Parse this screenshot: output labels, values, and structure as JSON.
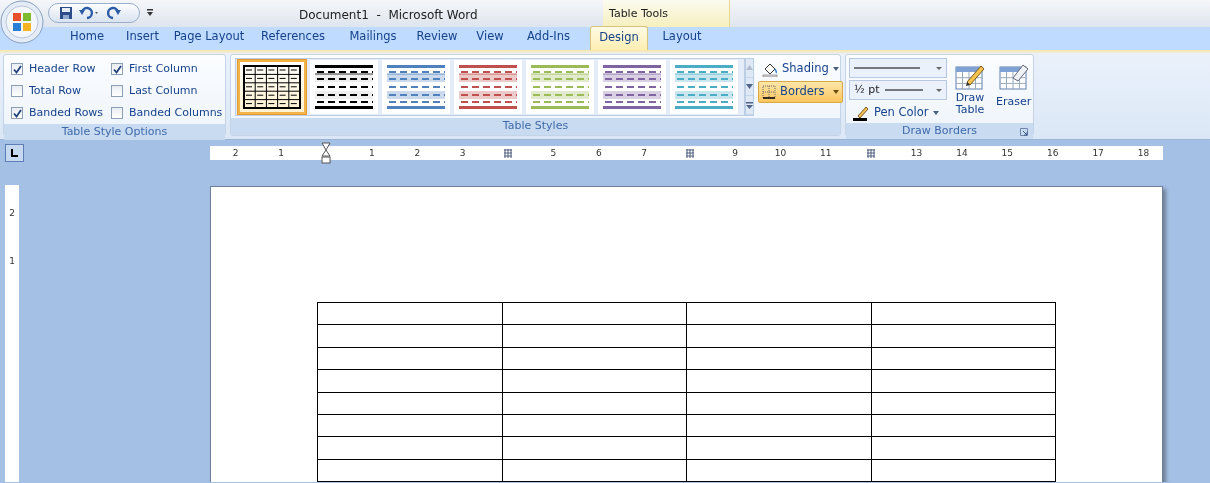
{
  "window": {
    "title": "Document1  -  Microsoft Word",
    "contextual_header": "Table Tools"
  },
  "tabs": [
    {
      "label": "Home",
      "selected": false
    },
    {
      "label": "Insert",
      "selected": false
    },
    {
      "label": "Page Layout",
      "selected": false
    },
    {
      "label": "References",
      "selected": false
    },
    {
      "label": "Mailings",
      "selected": false
    },
    {
      "label": "Review",
      "selected": false
    },
    {
      "label": "View",
      "selected": false
    },
    {
      "label": "Add-Ins",
      "selected": false
    },
    {
      "label": "Design",
      "selected": true
    },
    {
      "label": "Layout",
      "selected": false
    }
  ],
  "table_style_options": {
    "label": "Table Style Options",
    "options": [
      {
        "label": "Header Row",
        "checked": true
      },
      {
        "label": "First Column",
        "checked": true
      },
      {
        "label": "Total Row",
        "checked": false
      },
      {
        "label": "Last Column",
        "checked": false
      },
      {
        "label": "Banded Rows",
        "checked": true
      },
      {
        "label": "Banded Columns",
        "checked": false
      }
    ]
  },
  "table_styles": {
    "label": "Table Styles",
    "styles": [
      {
        "kind": "grid",
        "color": "#000000",
        "selected": true
      },
      {
        "kind": "banded",
        "color": "#000000",
        "selected": false
      },
      {
        "kind": "banded",
        "color": "#4f81bd",
        "selected": false
      },
      {
        "kind": "banded",
        "color": "#c0504d",
        "selected": false
      },
      {
        "kind": "banded",
        "color": "#9bbb59",
        "selected": false
      },
      {
        "kind": "banded",
        "color": "#8064a2",
        "selected": false
      },
      {
        "kind": "banded",
        "color": "#4bacc6",
        "selected": false
      }
    ],
    "shading": "Shading",
    "borders": "Borders"
  },
  "draw_borders": {
    "label": "Draw Borders",
    "weight": "½ pt",
    "pen_color": "Pen Color",
    "draw_table": "Draw Table",
    "eraser": "Eraser"
  },
  "ruler": [
    {
      "kind": "number",
      "label": "2"
    },
    {
      "kind": "number",
      "label": "1"
    },
    {
      "kind": "margin"
    },
    {
      "kind": "number",
      "label": "1"
    },
    {
      "kind": "number",
      "label": "2"
    },
    {
      "kind": "number",
      "label": "3"
    },
    {
      "kind": "marker"
    },
    {
      "kind": "number",
      "label": "5"
    },
    {
      "kind": "number",
      "label": "6"
    },
    {
      "kind": "number",
      "label": "7"
    },
    {
      "kind": "marker"
    },
    {
      "kind": "number",
      "label": "9"
    },
    {
      "kind": "number",
      "label": "10"
    },
    {
      "kind": "number",
      "label": "11"
    },
    {
      "kind": "marker"
    },
    {
      "kind": "number",
      "label": "13"
    },
    {
      "kind": "number",
      "label": "14"
    },
    {
      "kind": "number",
      "label": "15"
    },
    {
      "kind": "number",
      "label": "16"
    },
    {
      "kind": "number",
      "label": "17"
    },
    {
      "kind": "number",
      "label": "18"
    }
  ],
  "vertical_ruler": [
    "2",
    "1"
  ],
  "table": {
    "columns": [
      {
        "kind": "empty"
      },
      {
        "kind": "empty"
      },
      {
        "kind": "empty"
      },
      {
        "kind": "empty"
      }
    ],
    "rows": [
      {
        "kind": "empty"
      },
      {
        "kind": "empty"
      },
      {
        "kind": "empty"
      },
      {
        "kind": "empty"
      },
      {
        "kind": "empty"
      },
      {
        "kind": "empty"
      },
      {
        "kind": "empty"
      },
      {
        "kind": "empty"
      }
    ]
  }
}
